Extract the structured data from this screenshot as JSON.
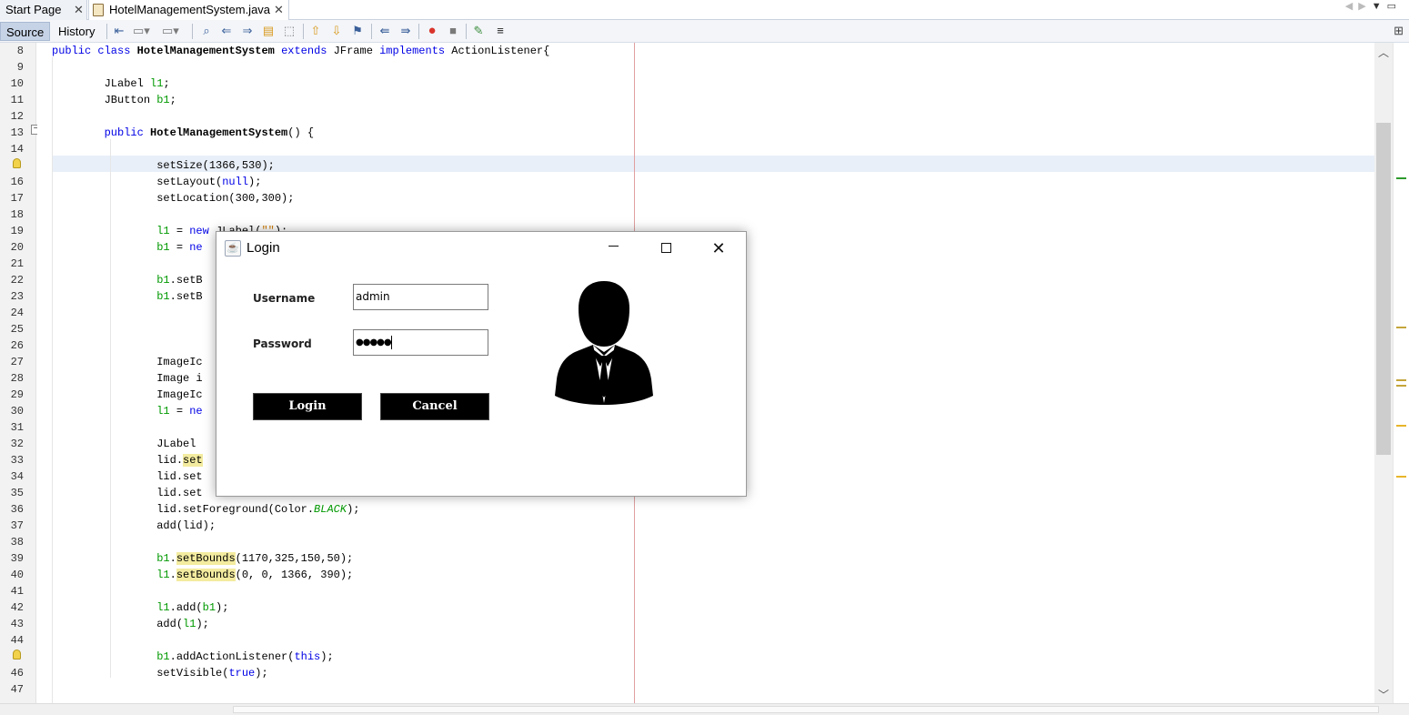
{
  "tabs": {
    "start_page": "Start Page",
    "active_file": "HotelManagementSystem.java",
    "close_glyph": "✕"
  },
  "toolbar": {
    "source": "Source",
    "history": "History"
  },
  "editor": {
    "line_numbers": [
      "8",
      "9",
      "10",
      "11",
      "12",
      "13",
      "14",
      "15",
      "16",
      "17",
      "18",
      "19",
      "20",
      "21",
      "22",
      "23",
      "24",
      "25",
      "26",
      "27",
      "28",
      "29",
      "30",
      "31",
      "32",
      "33",
      "34",
      "35",
      "36",
      "37",
      "38",
      "39",
      "40",
      "41",
      "42",
      "43",
      "44",
      "45",
      "46",
      "47"
    ],
    "current_line": "15",
    "bulb_lines": [
      "15",
      "45"
    ]
  },
  "dialog": {
    "title": "Login",
    "username_label": "Username",
    "username_value": "admin",
    "password_label": "Password",
    "password_value": "●●●●●",
    "login_button": "Login",
    "cancel_button": "Cancel",
    "avatar_icon": "businessman-silhouette-icon"
  },
  "colors": {
    "keyword": "#0000e6",
    "field": "#009900",
    "string": "#ce7b00",
    "highlight": "#f3eb9f",
    "current_line": "#e9eff8",
    "button_bg": "#000000"
  }
}
